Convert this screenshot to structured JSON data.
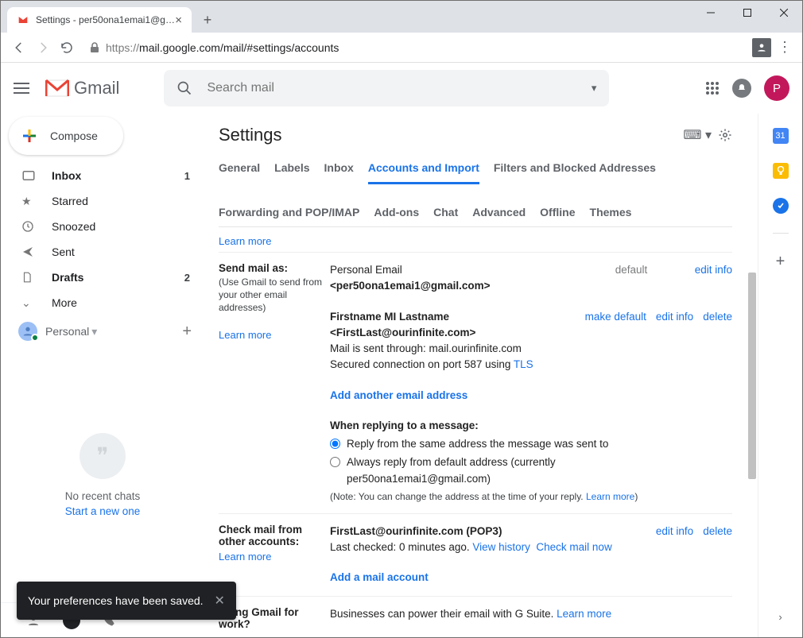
{
  "browser": {
    "tab_title": "Settings - per50ona1emai1@gm...",
    "url_protocol": "https://",
    "url_rest": "mail.google.com/mail/#settings/accounts"
  },
  "gmail": {
    "product": "Gmail",
    "search_placeholder": "Search mail",
    "avatar_letter": "P"
  },
  "leftnav": {
    "compose": "Compose",
    "inbox": "Inbox",
    "inbox_count": "1",
    "starred": "Starred",
    "snoozed": "Snoozed",
    "sent": "Sent",
    "drafts": "Drafts",
    "drafts_count": "2",
    "more": "More",
    "personal": "Personal"
  },
  "hangouts": {
    "no_recent": "No recent chats",
    "start_new": "Start a new one"
  },
  "settings": {
    "title": "Settings",
    "tabs": {
      "general": "General",
      "labels": "Labels",
      "inbox": "Inbox",
      "accounts": "Accounts and Import",
      "filters": "Filters and Blocked Addresses",
      "forwarding": "Forwarding and POP/IMAP",
      "addons": "Add-ons",
      "chat": "Chat",
      "advanced": "Advanced",
      "offline": "Offline",
      "themes": "Themes"
    },
    "learn_more": "Learn more",
    "send_as": {
      "title": "Send mail as:",
      "sub": "(Use Gmail to send from your other email addresses)",
      "primary_name": "Personal Email",
      "primary_addr": "<per50ona1emai1@gmail.com>",
      "default": "default",
      "edit_info": "edit info",
      "alt_name": "Firstname MI Lastname",
      "alt_addr": "<FirstLast@ourinfinite.com>",
      "alt_route": "Mail is sent through: mail.ourinfinite.com",
      "alt_secure_pre": "Secured connection on port 587 using ",
      "alt_secure_link": "TLS",
      "make_default": "make default",
      "delete": "delete",
      "add_another": "Add another email address",
      "reply_title": "When replying to a message:",
      "reply_same": "Reply from the same address the message was sent to",
      "reply_default_a": "Always reply from default address (currently ",
      "reply_default_b": "per50ona1emai1@gmail.com)",
      "note_a": "(Note: You can change the address at the time of your reply. ",
      "note_b": "Learn more",
      "note_c": ")"
    },
    "check_mail": {
      "title_a": "Check mail from",
      "title_b": "other accounts:",
      "acct": "FirstLast@ourinfinite.com (POP3)",
      "checked": "Last checked: 0 minutes ago. ",
      "view_history": "View history",
      "check_now": "Check mail now",
      "add": "Add a mail account"
    },
    "gsuite": {
      "title_a": "Using Gmail for",
      "title_b": "work?",
      "text": "Businesses can power their email with G Suite. "
    }
  },
  "toast": {
    "text": "Your preferences have been saved."
  },
  "sidepanel": {
    "cal": "31"
  }
}
